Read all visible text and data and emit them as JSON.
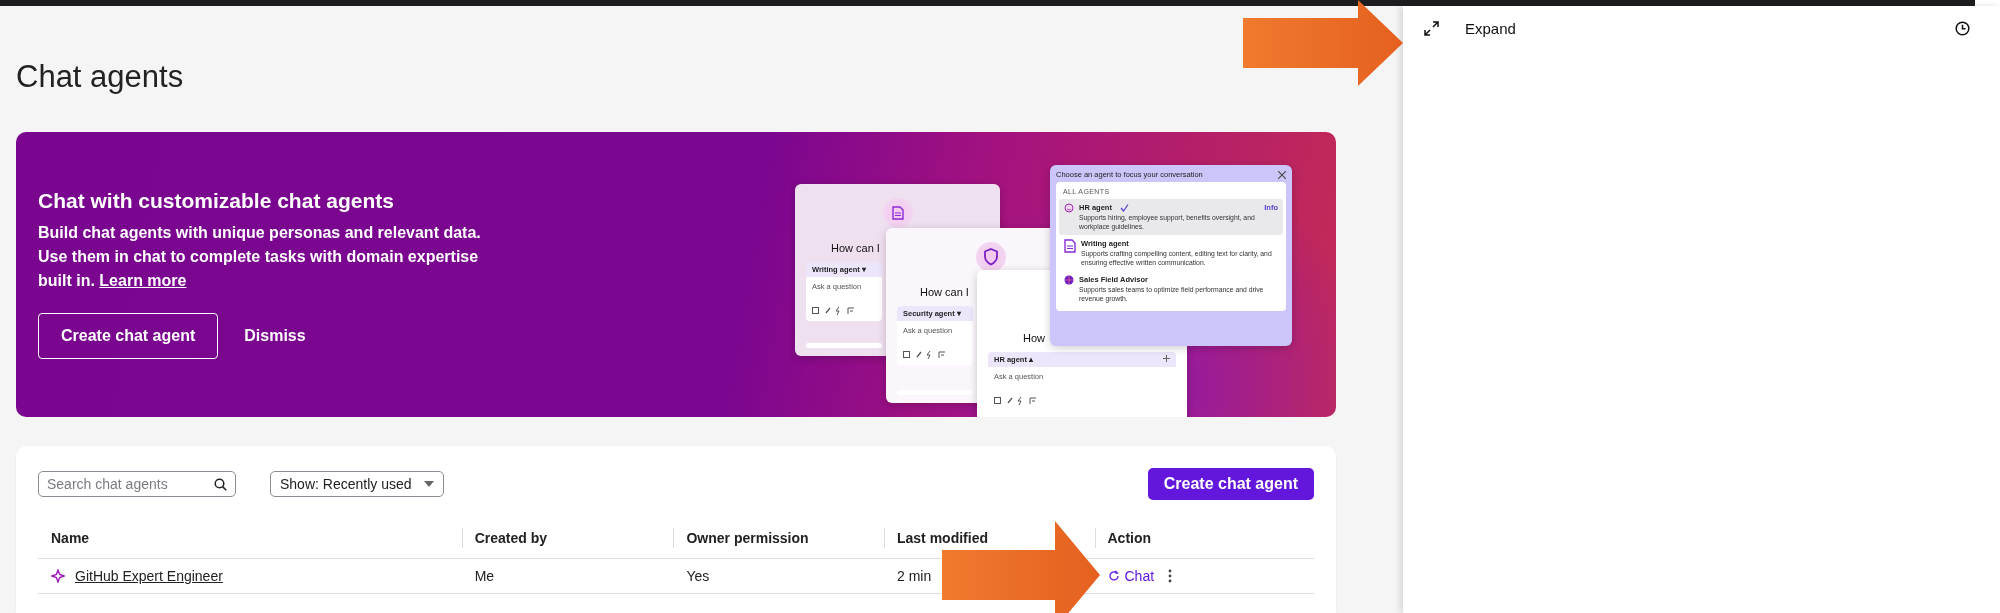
{
  "page": {
    "title": "Chat agents"
  },
  "banner": {
    "heading": "Chat with customizable chat agents",
    "body": "Build chat agents with unique personas and relevant data. Use them in chat to complete tasks with domain expertise built in.",
    "link": "Learn more",
    "buttons": [
      {
        "label": "Create chat agent",
        "kind": "outline"
      },
      {
        "label": "Dismiss",
        "kind": "text"
      }
    ],
    "illustration": {
      "cards": [
        {
          "prompt": "How can I",
          "agent": "Writing agent ▾",
          "placeholder": "Ask a question",
          "kind": "document"
        },
        {
          "prompt": "How can I",
          "agent": "Security agent ▾",
          "placeholder": "Ask a question",
          "kind": "shield"
        },
        {
          "prompt": "How",
          "agent": "HR agent ▴",
          "placeholder": "Ask a question",
          "kind": "plain"
        }
      ],
      "popup": {
        "title": "Choose an agent to focus your conversation",
        "section": "ALL AGENTS",
        "agents": [
          {
            "name": "HR agent",
            "description": "Supports hiring, employee support, benefits oversight, and workplace guidelines.",
            "selected": true,
            "info": "Info",
            "kind": "smiley"
          },
          {
            "name": "Writing agent",
            "description": "Supports crafting compelling content, editing text for clarity, and ensuring effective written communication.",
            "selected": false,
            "kind": "document"
          },
          {
            "name": "Sales Field Advisor",
            "description": "Supports sales teams to optimize field performance and drive revenue growth.",
            "selected": false,
            "kind": "globe"
          }
        ]
      }
    }
  },
  "toolbar": {
    "search": {
      "placeholder": "Search chat agents"
    },
    "filter": "Show: Recently used",
    "create_button": "Create chat agent"
  },
  "table": {
    "columns": [
      "Name",
      "Created by",
      "Owner permission",
      "Last modified",
      "Action"
    ],
    "rows": [
      {
        "name": "GitHub Expert Engineer",
        "created_by": "Me",
        "owner_permission": "Yes",
        "last_modified": "2 min",
        "action": "Chat"
      }
    ]
  },
  "side_panel": {
    "expand": "Expand"
  }
}
